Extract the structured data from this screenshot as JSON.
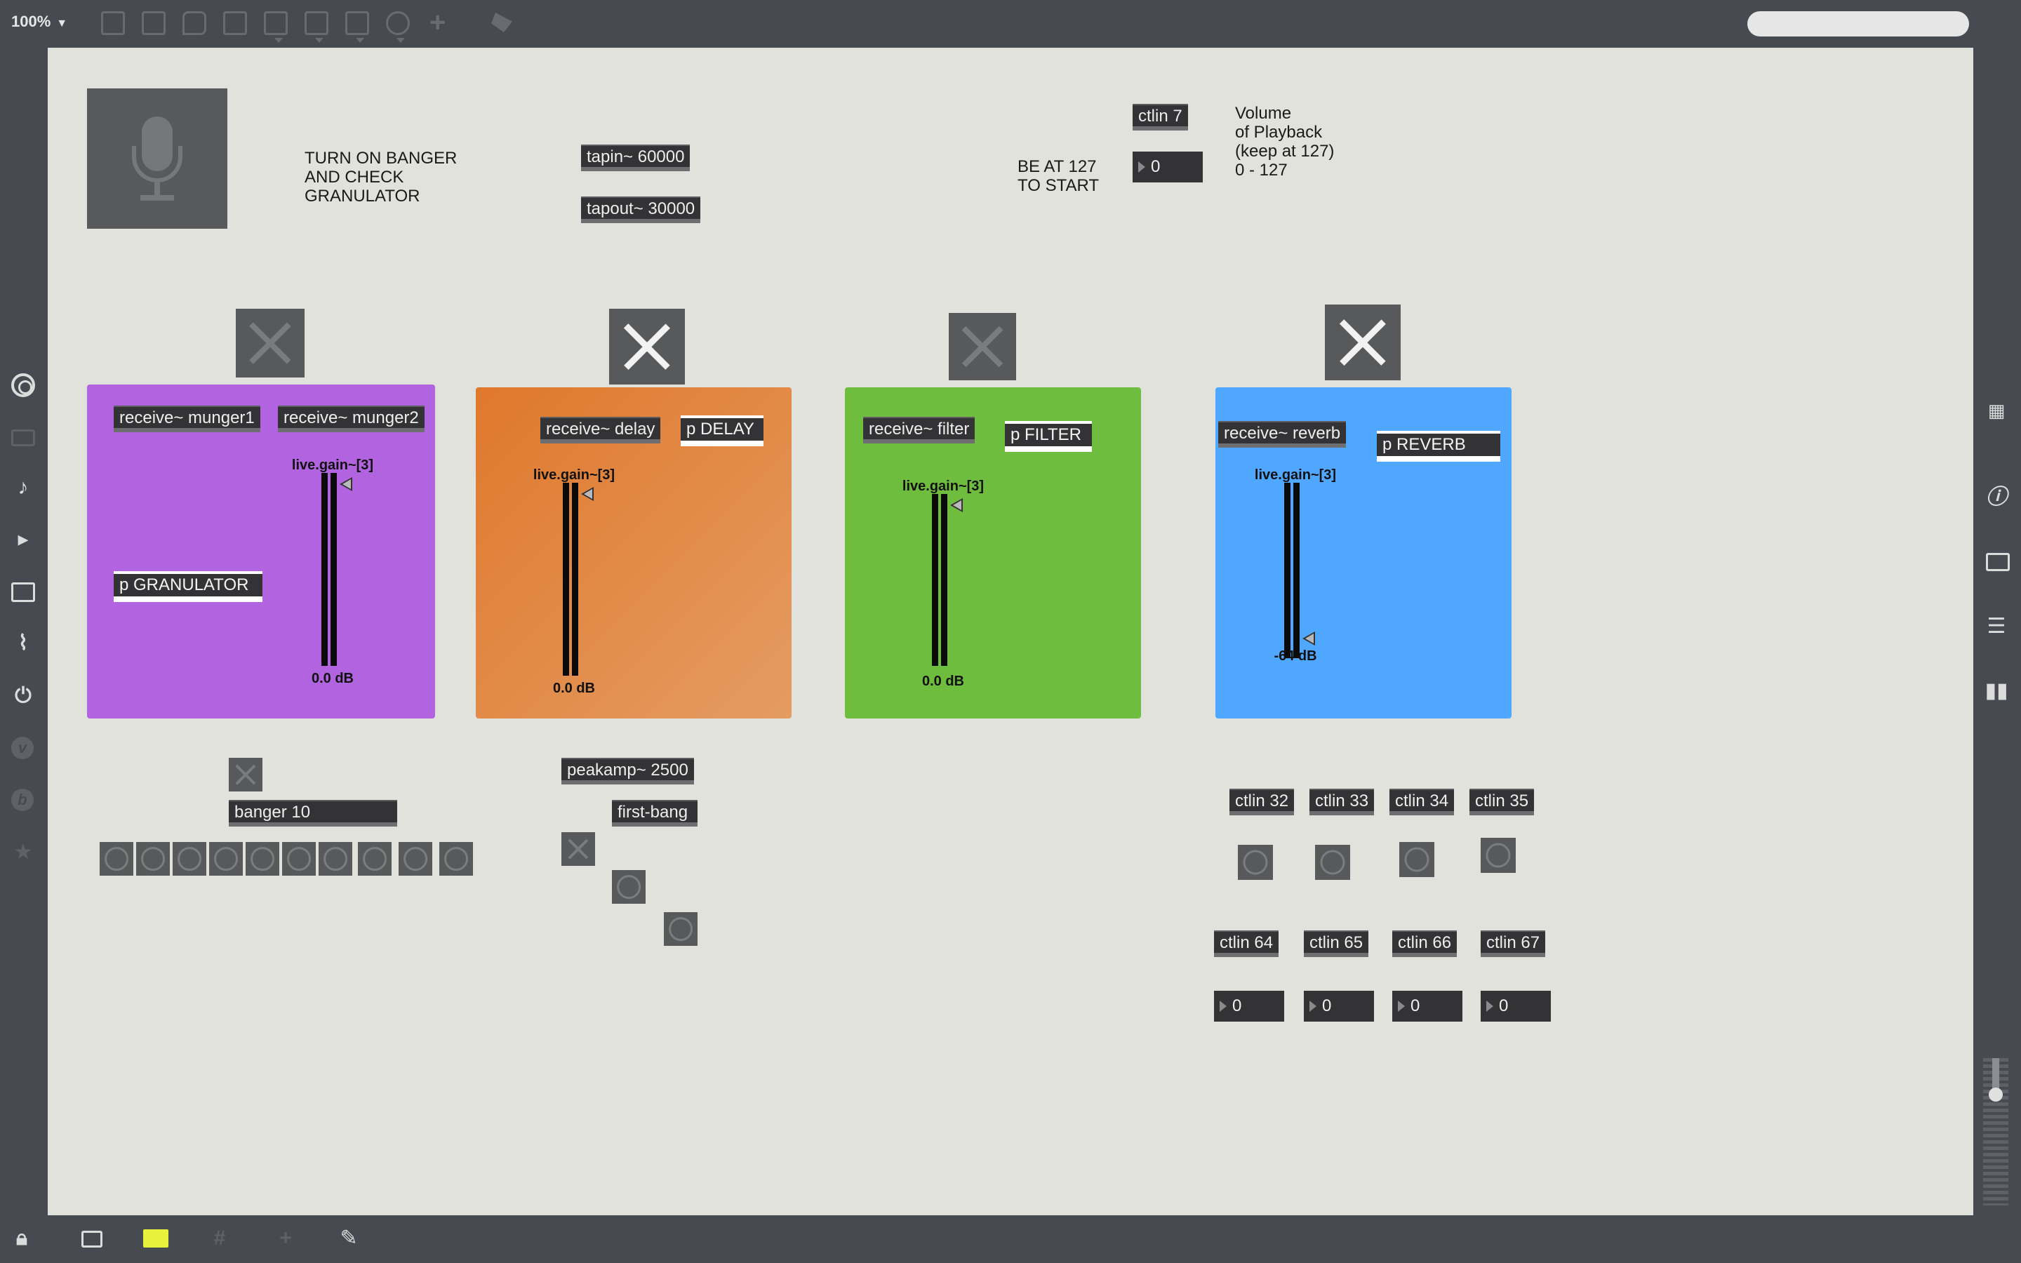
{
  "toolbar": {
    "zoom": "100%",
    "search_placeholder": ""
  },
  "colors": {
    "granulator_panel": "#b163e0",
    "delay_panel": "#e2883f",
    "filter_panel": "#6fbd3f",
    "reverb_panel": "#4fa7ff",
    "canvas": "#e2e2dc",
    "chrome": "#474b51",
    "presentation_active": "#e7f23b"
  },
  "comments": {
    "turn_on": "TURN ON BANGER\nAND CHECK\nGRANULATOR",
    "be_at": "BE AT 127\nTO START",
    "volume": "Volume\nof Playback\n(keep at 127)\n0 - 127"
  },
  "objects": {
    "tapin": "tapin~ 60000",
    "tapout": "tapout~ 30000",
    "ctlin7": "ctlin 7",
    "ctlin7_value": "0",
    "receive_munger1": "receive~ munger1",
    "receive_munger2": "receive~ munger2",
    "p_granulator": "p GRANULATOR",
    "receive_delay": "receive~ delay",
    "p_delay": "p DELAY",
    "receive_filter": "receive~ filter",
    "p_filter": "p FILTER",
    "receive_reverb": "receive~ reverb",
    "p_reverb": "p REVERB",
    "banger": "banger 10",
    "peakamp": "peakamp~ 2500",
    "first_bang": "first-bang",
    "ctlin32": "ctlin 32",
    "ctlin33": "ctlin 33",
    "ctlin34": "ctlin 34",
    "ctlin35": "ctlin 35",
    "ctlin64": "ctlin 64",
    "ctlin65": "ctlin 65",
    "ctlin66": "ctlin 66",
    "ctlin67": "ctlin 67",
    "num64": "0",
    "num65": "0",
    "num66": "0",
    "num67": "0"
  },
  "gains": {
    "granulator": {
      "label": "live.gain~[3]",
      "value": "0.0 dB",
      "level": 0.0
    },
    "delay": {
      "label": "live.gain~[3]",
      "value": "0.0 dB",
      "level": 0.0
    },
    "filter": {
      "label": "live.gain~[3]",
      "value": "0.0 dB",
      "level": 0.0
    },
    "reverb": {
      "label": "live.gain~[3]",
      "value": "-64 dB",
      "level": -64
    }
  },
  "toggles": {
    "granulator_enabled": false,
    "delay_enabled": true,
    "filter_enabled": false,
    "reverb_enabled": true
  },
  "icons": {
    "left_sidebar": [
      "target-icon",
      "tray-icon",
      "music-note-icon",
      "step-icon",
      "image-icon",
      "paperclip-icon",
      "plug-icon",
      "vimeo-icon",
      "b-icon",
      "star-icon"
    ],
    "right_sidebar": [
      "keyboard-icon",
      "info-icon",
      "columns-icon",
      "list-icon",
      "book-icon",
      "volume-slider-icon",
      "power-icon"
    ],
    "bottom_bar": [
      "lock-icon",
      "new-window-icon",
      "presentation-icon",
      "grid-icon",
      "add-icon",
      "wrench-icon"
    ]
  }
}
